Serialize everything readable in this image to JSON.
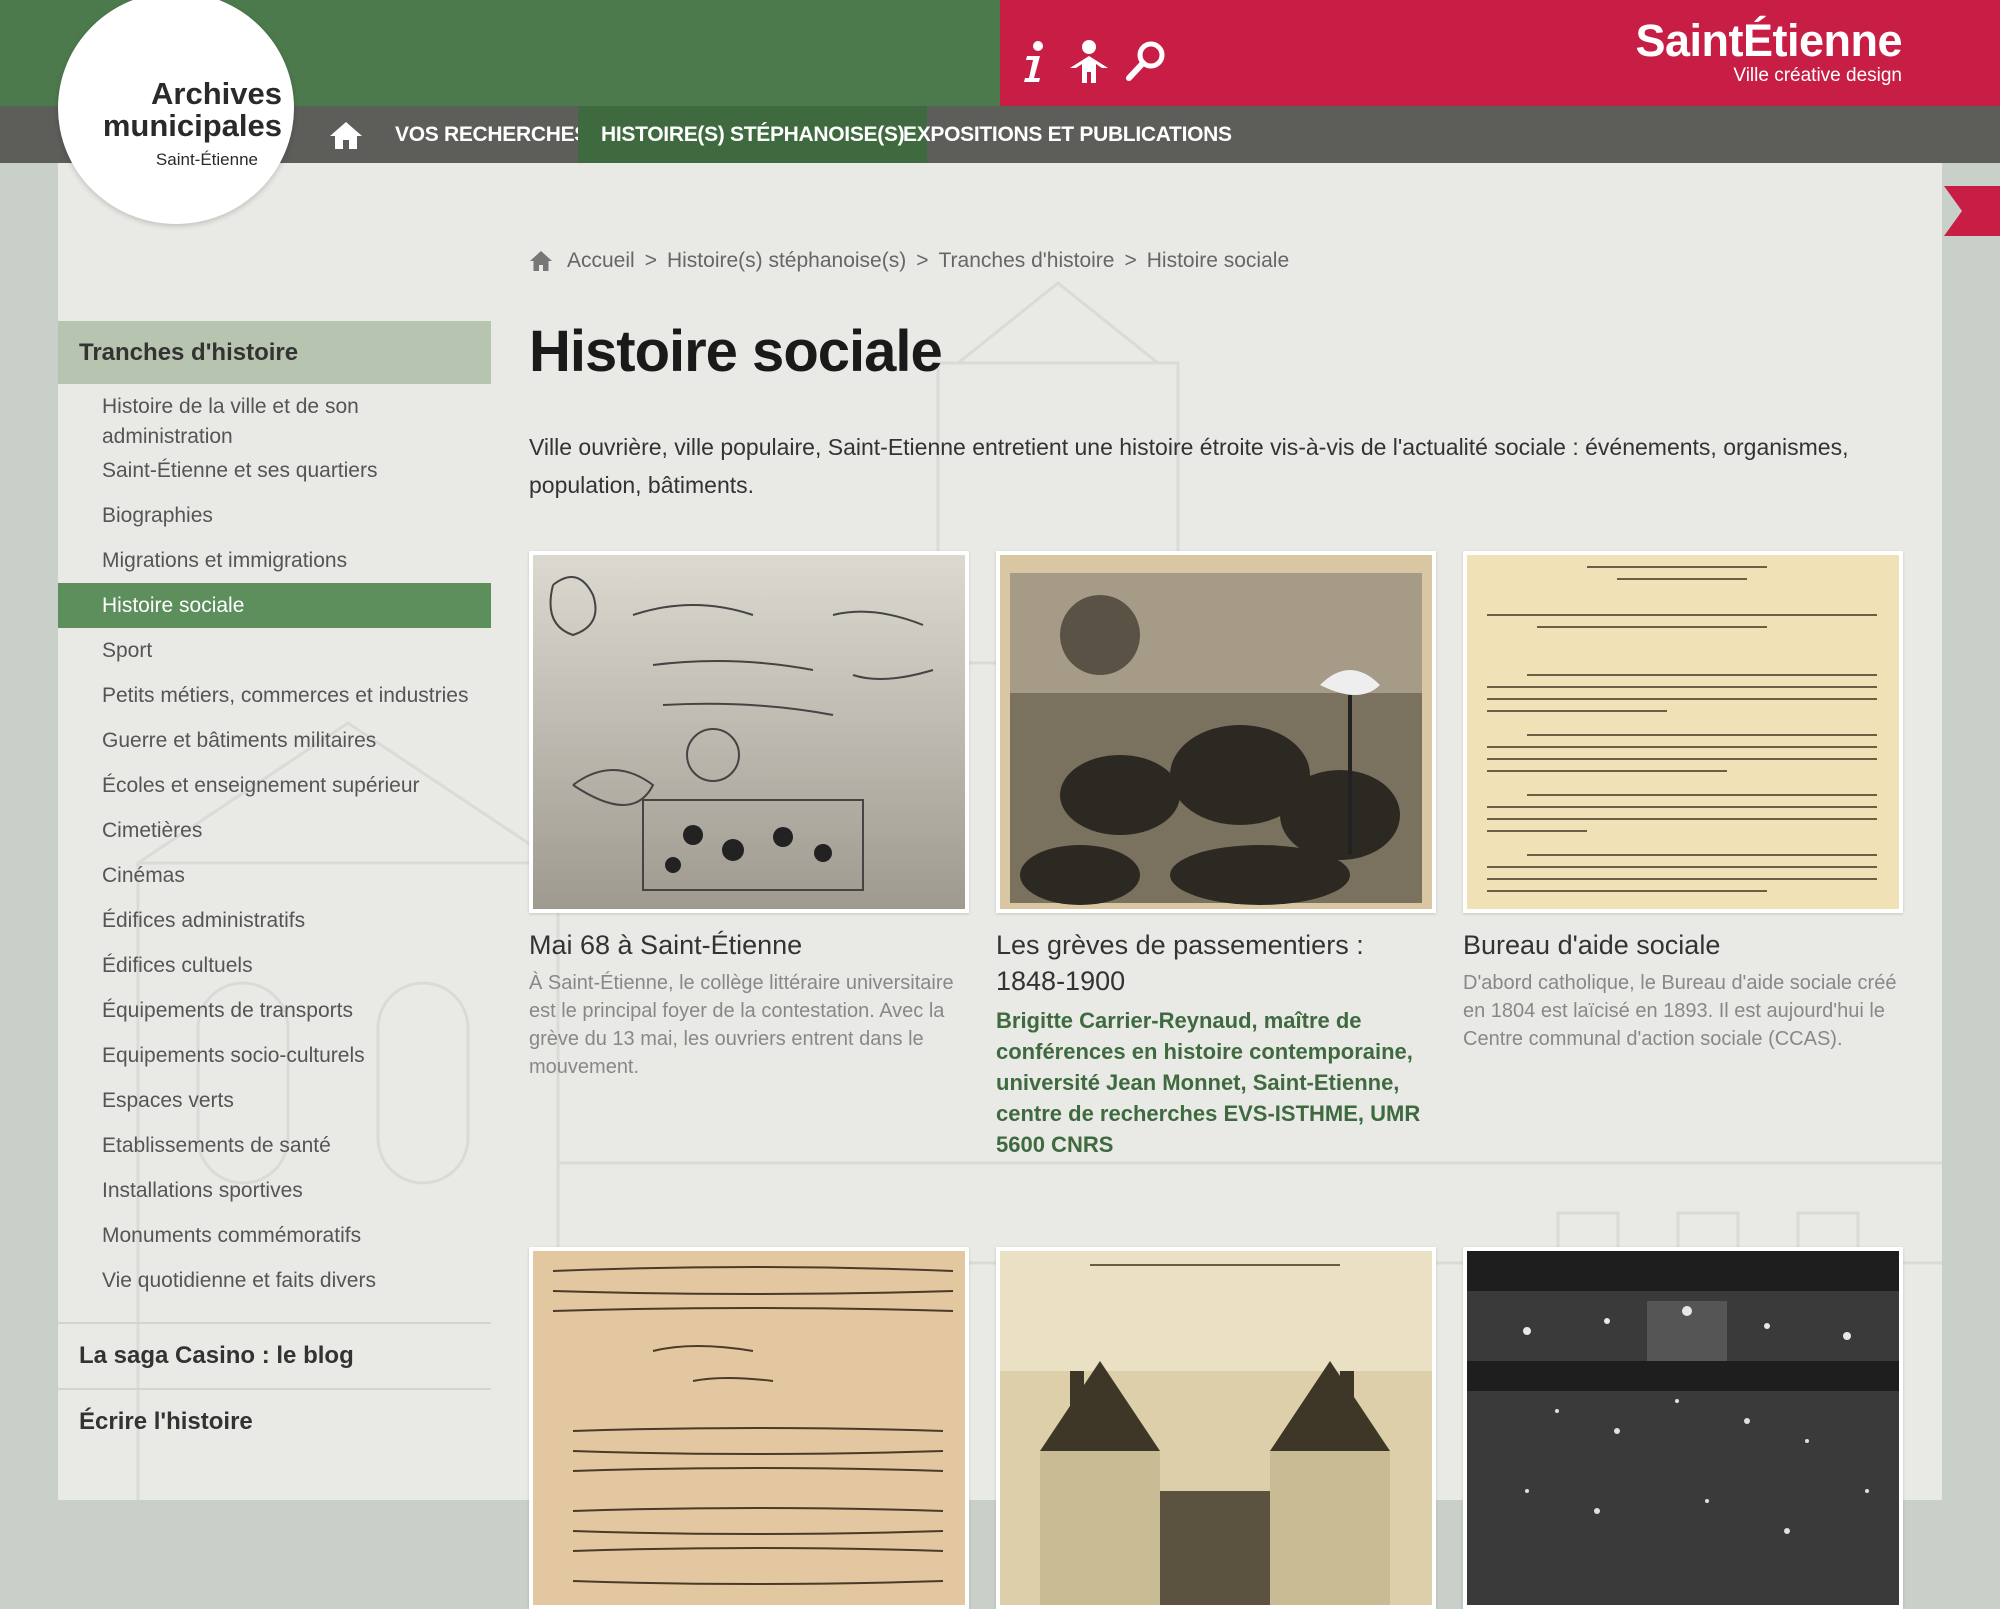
{
  "header": {
    "logo": {
      "line1": "Archives",
      "line2": "municipales",
      "line3": "Saint-Étienne"
    },
    "brand": {
      "name": "SaintÉtienne",
      "tagline": "Ville créative design"
    },
    "tools": [
      "info-icon",
      "person-icon",
      "search-icon"
    ],
    "colors": {
      "green": "#4d7a4d",
      "red": "#c81e45",
      "nav": "#5d5d5a",
      "nav_active": "#3f6a3f"
    }
  },
  "nav": {
    "items": [
      {
        "label": "VOS RECHERCHES",
        "active": false
      },
      {
        "label": "HISTOIRE(S) STÉPHANOISE(S)",
        "active": true
      },
      {
        "label": "EXPOSITIONS ET PUBLICATIONS",
        "active": false
      }
    ]
  },
  "breadcrumb": [
    "Accueil",
    "Histoire(s) stéphanoise(s)",
    "Tranches d'histoire",
    "Histoire sociale"
  ],
  "sidebar": {
    "heading": "Tranches d'histoire",
    "items": [
      {
        "label": "Histoire de la ville et de son administration",
        "active": false
      },
      {
        "label": "Saint-Étienne et ses quartiers",
        "active": false
      },
      {
        "label": "Biographies",
        "active": false
      },
      {
        "label": "Migrations et immigrations",
        "active": false
      },
      {
        "label": "Histoire sociale",
        "active": true
      },
      {
        "label": "Sport",
        "active": false
      },
      {
        "label": "Petits métiers, commerces et industries",
        "active": false
      },
      {
        "label": "Guerre et bâtiments militaires",
        "active": false
      },
      {
        "label": "Écoles et enseignement supérieur",
        "active": false
      },
      {
        "label": "Cimetières",
        "active": false
      },
      {
        "label": "Cinémas",
        "active": false
      },
      {
        "label": "Édifices administratifs",
        "active": false
      },
      {
        "label": "Édifices cultuels",
        "active": false
      },
      {
        "label": "Équipements de transports",
        "active": false
      },
      {
        "label": "Equipements socio-culturels",
        "active": false
      },
      {
        "label": "Espaces verts",
        "active": false
      },
      {
        "label": "Etablissements de santé",
        "active": false
      },
      {
        "label": "Installations sportives",
        "active": false
      },
      {
        "label": "Monuments commémoratifs",
        "active": false
      },
      {
        "label": "Vie quotidienne et faits divers",
        "active": false
      }
    ],
    "bottom_links": [
      "La saga Casino : le blog",
      "Écrire l'histoire"
    ]
  },
  "main": {
    "title": "Histoire sociale",
    "intro": "Ville ouvrière, ville populaire, Saint-Etienne entretient une histoire étroite vis-à-vis de l'actualité sociale : événements, organismes, population, bâtiments.",
    "cards": [
      {
        "title": "Mai 68 à Saint-Étienne",
        "desc": "À Saint-Étienne, le collège littéraire universitaire est le principal foyer de la contestation. Avec la grève du 13 mai, les ouvriers entrent dans le mouvement."
      },
      {
        "title": "Les grèves de passementiers : 1848-1900",
        "author": "Brigitte Carrier-Reynaud, maître de conférences en histoire contemporaine, université Jean Monnet, Saint-Etienne, centre de recherches EVS-ISTHME, UMR 5600 CNRS"
      },
      {
        "title": "Bureau d'aide sociale",
        "desc": "D'abord catholique, le Bureau d'aide sociale créé en 1804 est laïcisé en 1893. Il est aujourd'hui le Centre communal d'action sociale (CCAS)."
      }
    ]
  }
}
